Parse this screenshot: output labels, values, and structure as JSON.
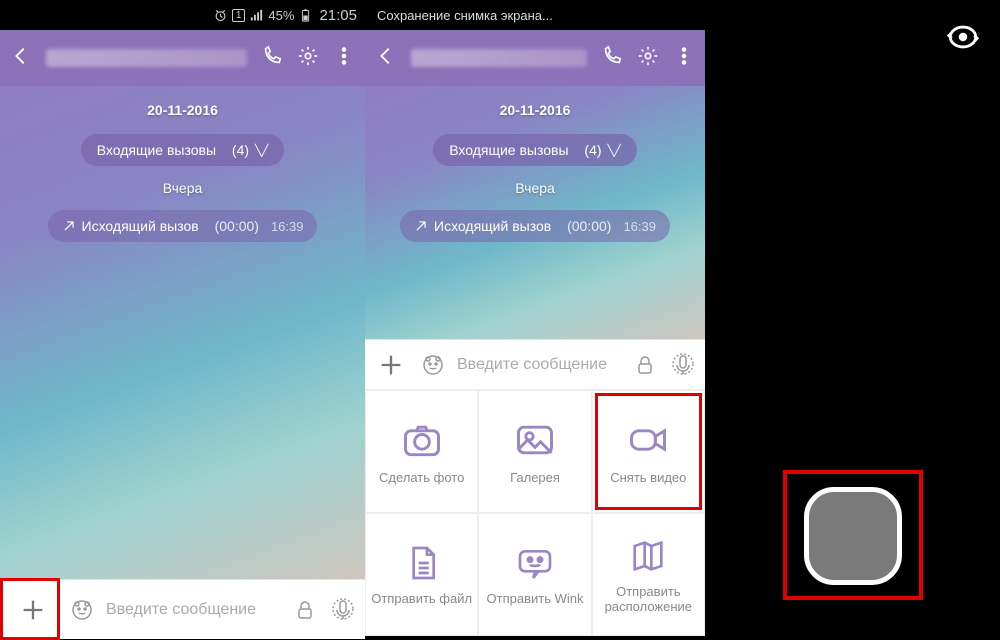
{
  "statusbar": {
    "time": "21:05",
    "battery": "45%",
    "sim_index": "1",
    "toast": "Сохранение снимка экрана..."
  },
  "chat": {
    "date_label": "20-11-2016",
    "incoming_label": "Входящие вызовы",
    "incoming_count": "(4)",
    "yesterday_label": "Вчера",
    "outgoing_label": "Исходящий вызов",
    "duration": "(00:00)",
    "msg_time": "16:39"
  },
  "input": {
    "placeholder": "Введите сообщение"
  },
  "attachments": {
    "photo": "Сделать фото",
    "gallery": "Галерея",
    "video": "Снять видео",
    "file": "Отправить файл",
    "wink": "Отправить Wink",
    "location": "Отправить расположение"
  }
}
